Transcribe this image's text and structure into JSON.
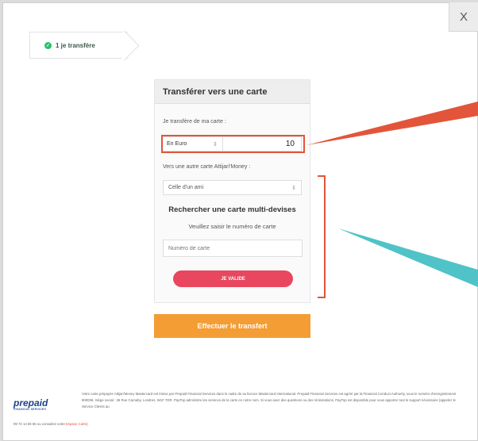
{
  "window": {
    "close_label": "X"
  },
  "step": {
    "label": "1 je transfère",
    "check_icon": "check-circle-icon"
  },
  "form": {
    "title": "Transférer vers une carte",
    "from_label": "Je transfère de ma carte :",
    "currency_value": "En Euro",
    "amount_value": "10",
    "to_label": "Vers une autre carte Attijari'Money :",
    "destination_value": "Celle d'un ami",
    "search_title": "Rechercher une carte multi-devises",
    "search_subtitle": "Veuillez saisir le numéro de carte",
    "card_number_placeholder": "Numéro de carte",
    "validate_label": "JE VALIDE"
  },
  "submit": {
    "label": "Effectuer le transfert"
  },
  "footer": {
    "logo_text": "prepaid",
    "logo_sub": "FINANCIAL SERVICES",
    "legal_text": "Votre carte prépayée Attijari'Money Mastercard est émise par Prepaid Financial Services dans le cadre de sa licence Mastercard International. Prepaid Financial Services est agréé par la Financial Conduct Authority, sous le numéro d'enregistrement 900036. Siège social : 36 Rue Carnaby, Londres, W1F 7DR. PayTop administre les services de la carte en notre nom. Si vous avez des questions ou des réclamations, PayTop est disponible pour vous apporter tout le support nécessaire (appelez le Service Clients au",
    "legal_tail": "09 72 14 66 66 ou consultez votre",
    "legal_link": "Espace Carte",
    "legal_end": ")."
  },
  "colors": {
    "accent_orange": "#f39d34",
    "validate_pink": "#e8475f",
    "highlight_red": "#e2553a",
    "arrow_teal": "#4fc3c8",
    "check_green": "#2cbf6b"
  }
}
